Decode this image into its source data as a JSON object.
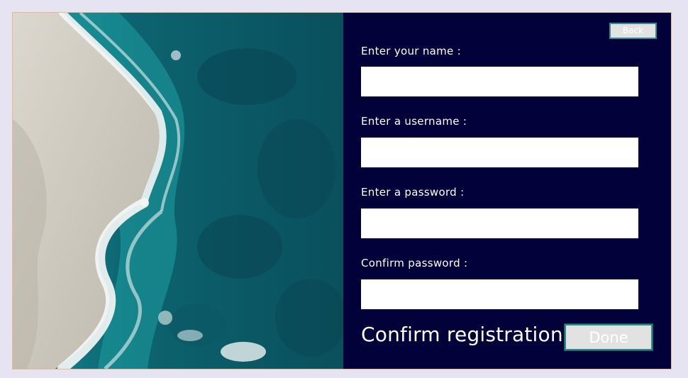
{
  "form": {
    "back_label": "Back",
    "fields": [
      {
        "label": "Enter your name :",
        "value": ""
      },
      {
        "label": "Enter a username :",
        "value": ""
      },
      {
        "label": "Enter a password :",
        "value": ""
      },
      {
        "label": "Confirm password :",
        "value": ""
      }
    ],
    "confirm_title": "Confirm registration",
    "done_label": "Done"
  },
  "colors": {
    "panel_background": "#02013a",
    "ocean": "#0b5f6a",
    "sand": "#cfcbc2",
    "button_fill": "#e2e2e2",
    "button_border": "#2a8f86"
  }
}
